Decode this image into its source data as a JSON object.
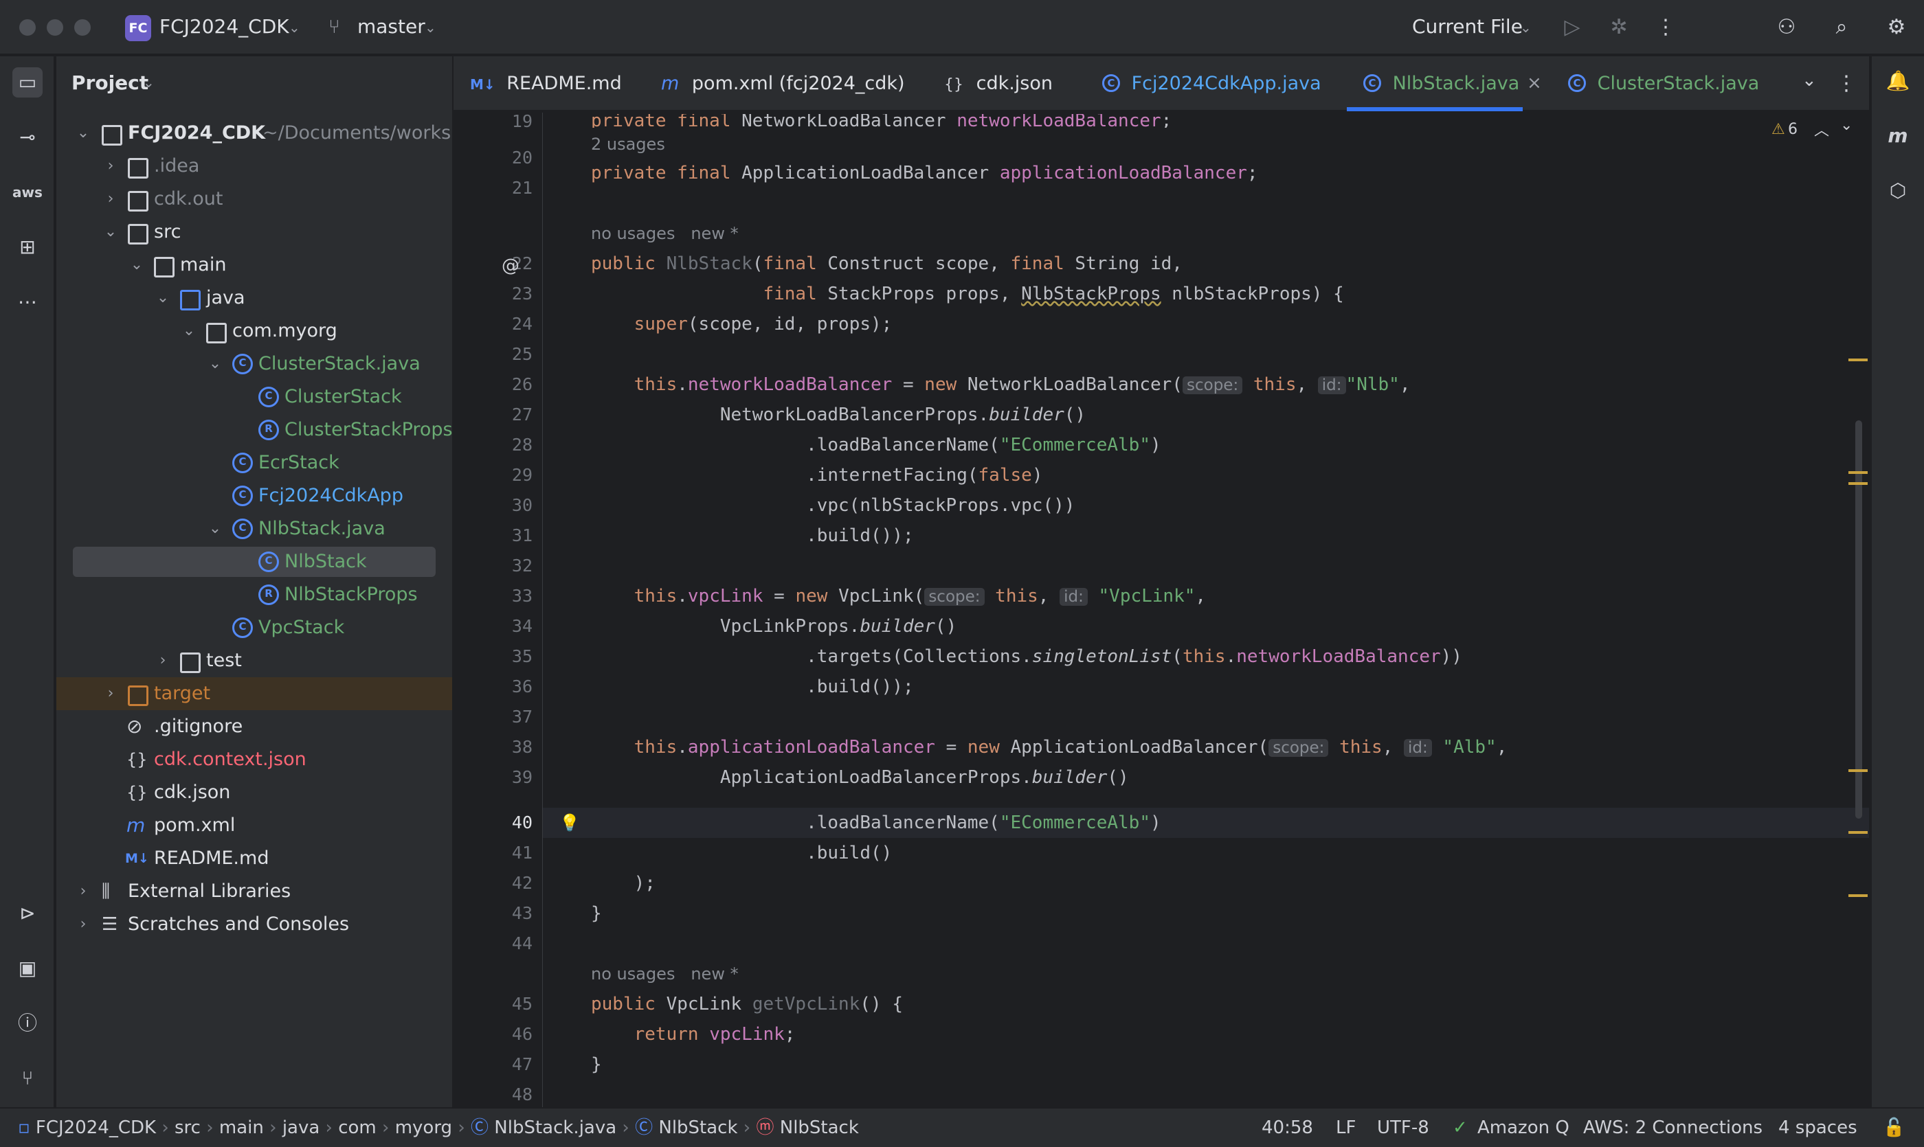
{
  "titlebar": {
    "project_badge": "FC",
    "project_name": "FCJ2024_CDK",
    "branch": "master",
    "run_config": "Current File"
  },
  "project_panel": {
    "title": "Project",
    "tree": [
      {
        "label": "FCJ2024_CDK",
        "suffix": "~/Documents/worksho"
      },
      {
        "label": ".idea"
      },
      {
        "label": "cdk.out"
      },
      {
        "label": "src"
      },
      {
        "label": "main"
      },
      {
        "label": "java"
      },
      {
        "label": "com.myorg"
      },
      {
        "label": "ClusterStack.java"
      },
      {
        "label": "ClusterStack"
      },
      {
        "label": "ClusterStackProps"
      },
      {
        "label": "EcrStack"
      },
      {
        "label": "Fcj2024CdkApp"
      },
      {
        "label": "NlbStack.java"
      },
      {
        "label": "NlbStack"
      },
      {
        "label": "NlbStackProps"
      },
      {
        "label": "VpcStack"
      },
      {
        "label": "test"
      },
      {
        "label": "target"
      },
      {
        "label": ".gitignore"
      },
      {
        "label": "cdk.context.json"
      },
      {
        "label": "cdk.json"
      },
      {
        "label": "pom.xml"
      },
      {
        "label": "README.md"
      },
      {
        "label": "External Libraries"
      },
      {
        "label": "Scratches and Consoles"
      }
    ]
  },
  "tabs": [
    {
      "prefix": "M↓",
      "label": "README.md"
    },
    {
      "prefix": "m",
      "label": "pom.xml (fcj2024_cdk)"
    },
    {
      "prefix": "{}",
      "label": "cdk.json"
    },
    {
      "prefix": "C",
      "label": "Fcj2024CdkApp.java"
    },
    {
      "prefix": "C",
      "label": "NlbStack.java"
    },
    {
      "prefix": "C",
      "label": "ClusterStack.java"
    }
  ],
  "editor": {
    "warnings": "6",
    "hints": {
      "usages2": "2 usages",
      "nousages": "no usages",
      "new": "new *"
    },
    "params": {
      "scope": "scope:",
      "id": "id:"
    },
    "line_numbers": [
      "19",
      "20",
      "21",
      "22",
      "23",
      "24",
      "25",
      "26",
      "27",
      "28",
      "29",
      "30",
      "31",
      "32",
      "33",
      "34",
      "35",
      "36",
      "37",
      "38",
      "39",
      "40",
      "41",
      "42",
      "43",
      "44",
      "45",
      "46",
      "47",
      "48"
    ]
  },
  "statusbar": {
    "breadcrumb": [
      "FCJ2024_CDK",
      "src",
      "main",
      "java",
      "com",
      "myorg",
      "NlbStack.java",
      "NlbStack",
      "NlbStack"
    ],
    "position": "40:58",
    "line_sep": "LF",
    "encoding": "UTF-8",
    "amazonq": "Amazon Q",
    "aws": "AWS: 2 Connections",
    "indent": "4 spaces"
  }
}
